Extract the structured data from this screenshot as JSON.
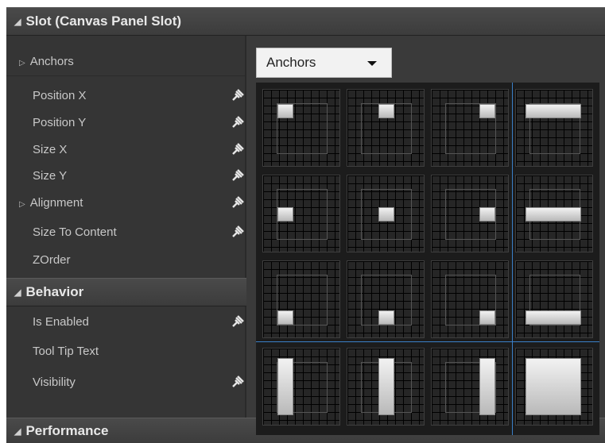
{
  "slot_section": {
    "title": "Slot (Canvas Panel Slot)"
  },
  "anchors_row": {
    "label": "Anchors"
  },
  "anchors_dropdown": {
    "label": "Anchors"
  },
  "slot_properties": [
    {
      "label": "Position X",
      "pin": true,
      "expandable": false
    },
    {
      "label": "Position Y",
      "pin": true,
      "expandable": false
    },
    {
      "label": "Size X",
      "pin": true,
      "expandable": false
    },
    {
      "label": "Size Y",
      "pin": true,
      "expandable": false
    },
    {
      "label": "Alignment",
      "pin": true,
      "expandable": true
    },
    {
      "label": "Size To Content",
      "pin": true,
      "expandable": false
    },
    {
      "label": "ZOrder",
      "pin": false,
      "expandable": false
    }
  ],
  "behavior_section": {
    "title": "Behavior"
  },
  "behavior_properties": [
    {
      "label": "Is Enabled",
      "pin": true
    },
    {
      "label": "Tool Tip Text",
      "pin": false
    },
    {
      "label": "Visibility",
      "pin": true
    }
  ],
  "performance_section": {
    "title": "Performance"
  },
  "anchor_presets": [
    [
      "top-left",
      "top-center",
      "top-right",
      "top-stretch"
    ],
    [
      "center-left",
      "center",
      "center-right",
      "center-stretch"
    ],
    [
      "bottom-left",
      "bottom-center",
      "bottom-right",
      "bottom-stretch"
    ],
    [
      "stretch-left",
      "stretch-center",
      "stretch-right",
      "stretch-full"
    ]
  ],
  "colors": {
    "accent_line": "#3a7fc8",
    "panel_bg": "#3a3a3a"
  }
}
